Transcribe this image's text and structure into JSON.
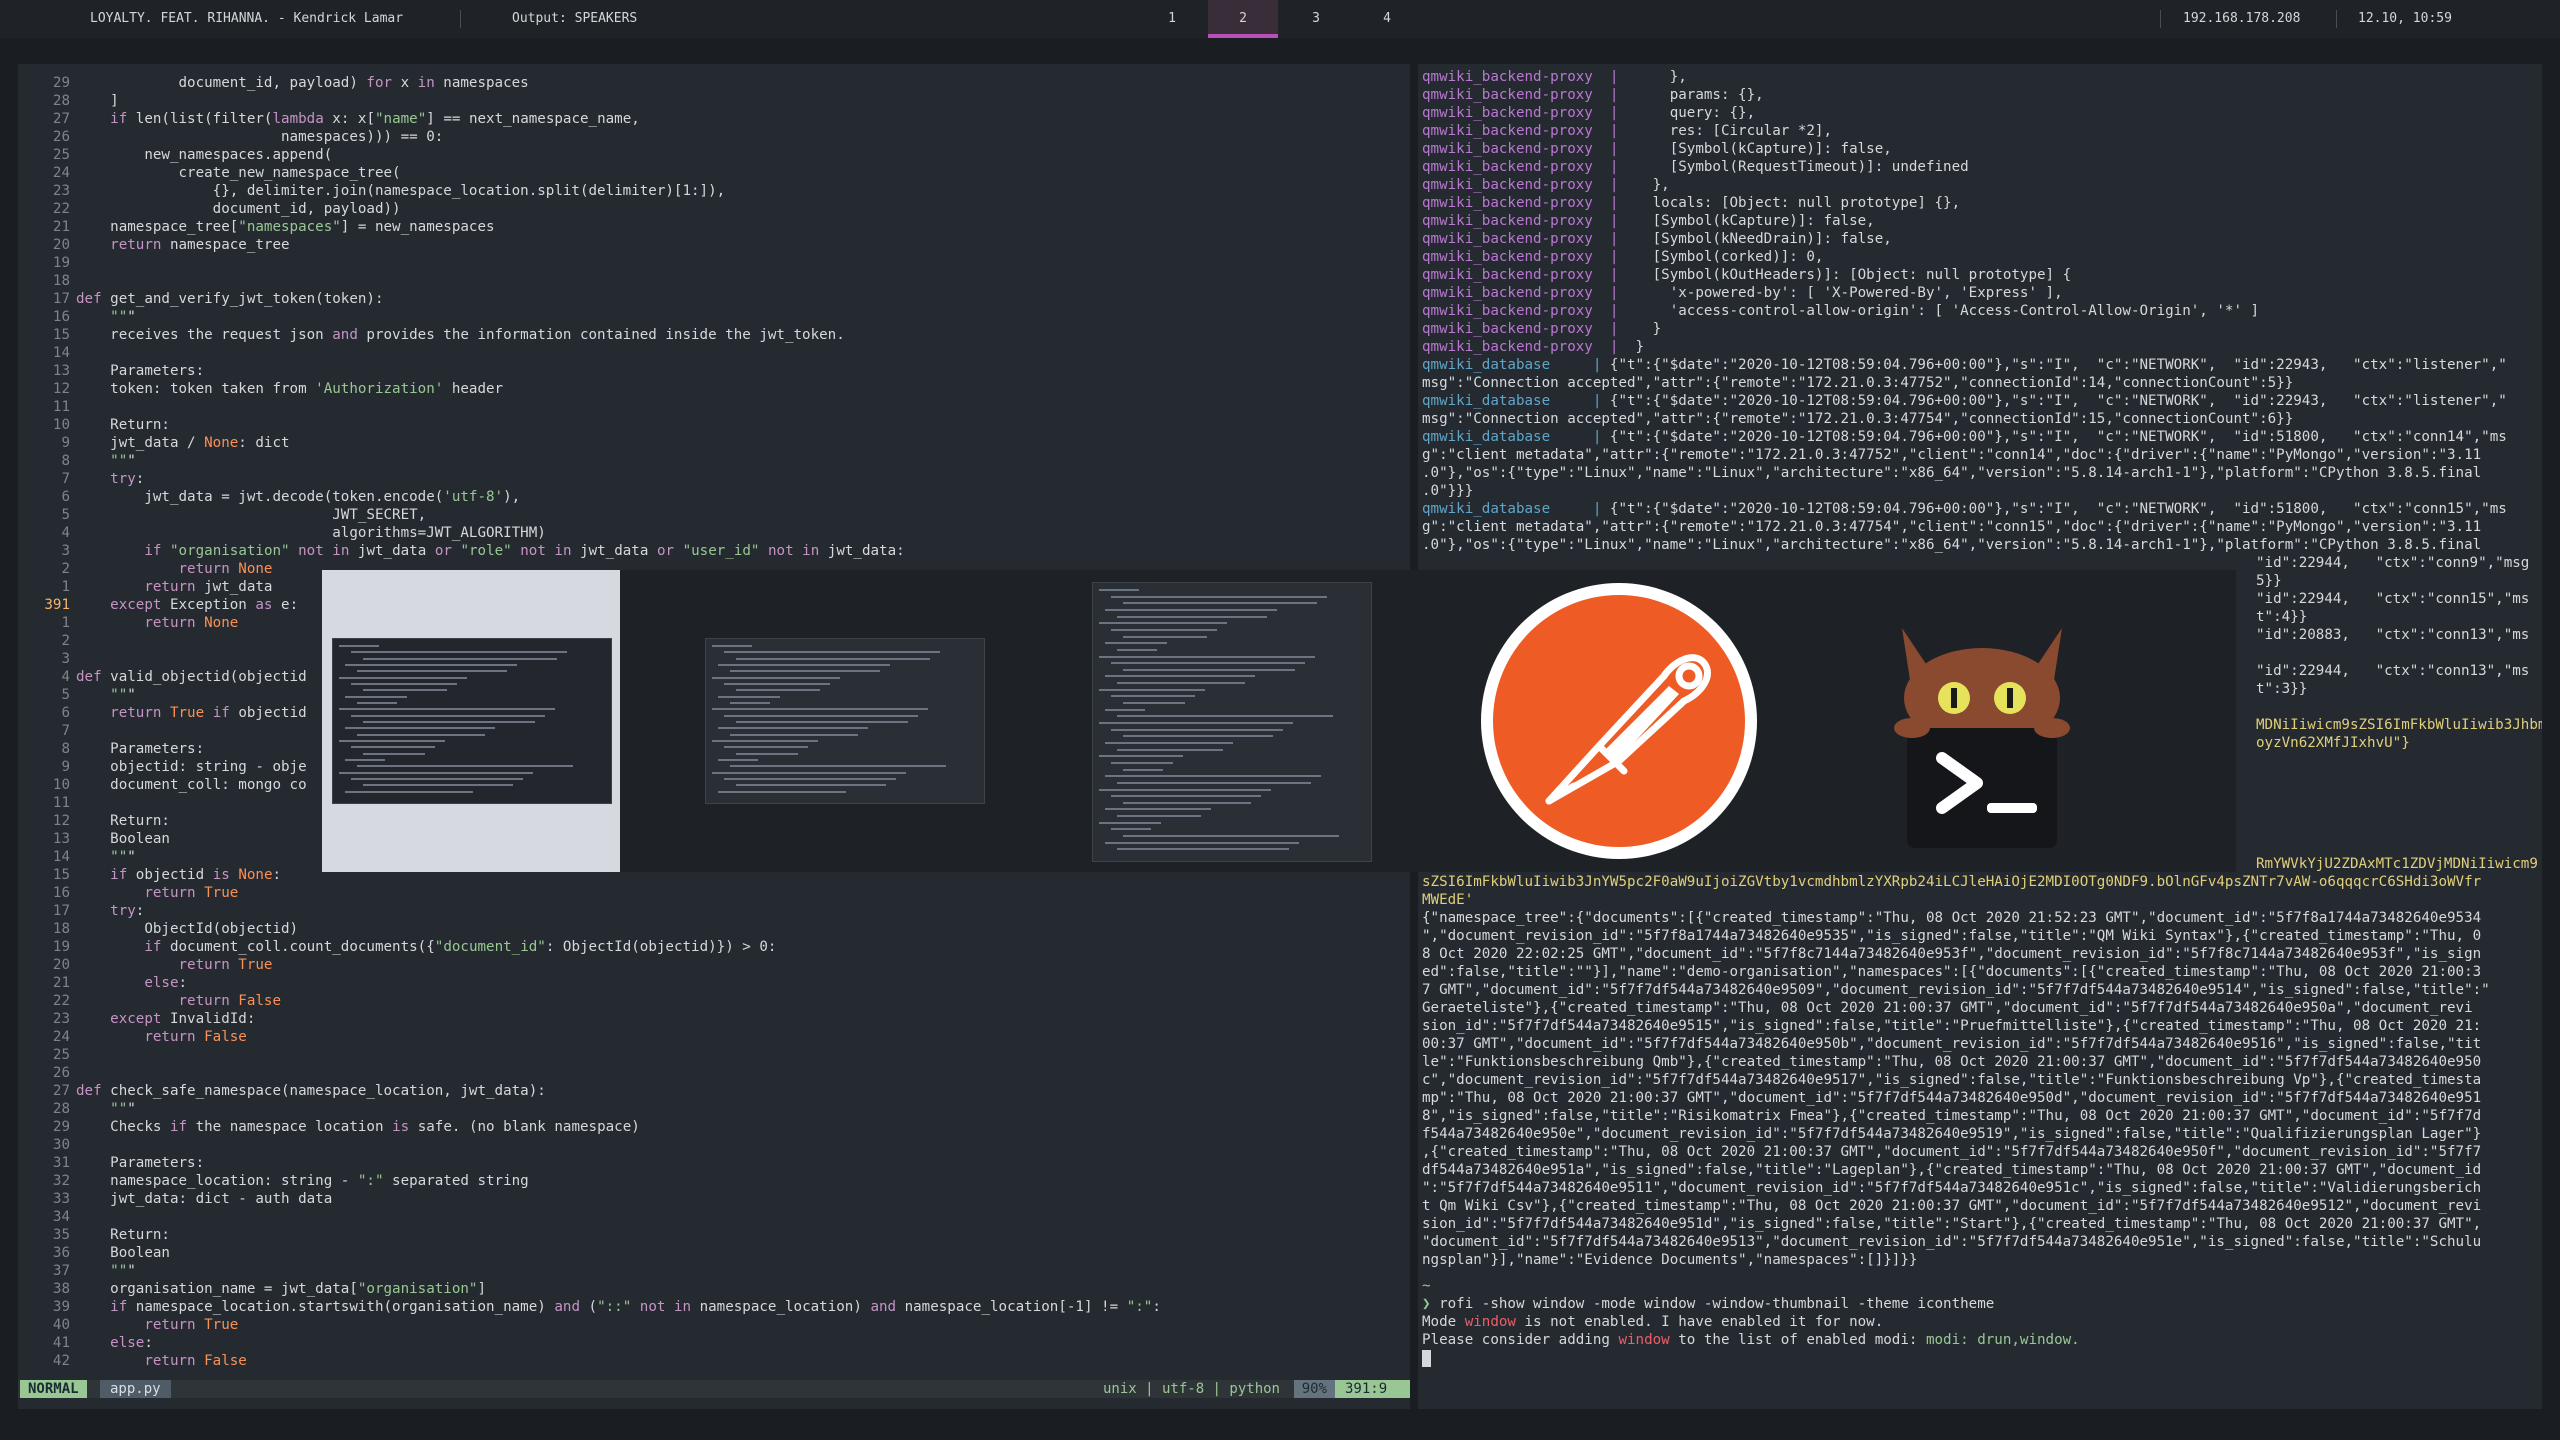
{
  "topbar": {
    "now_playing": "LOYALTY. FEAT. RIHANNA. - Kendrick Lamar",
    "audio_output": "Output: SPEAKERS",
    "workspaces": [
      "1",
      "2",
      "3",
      "4"
    ],
    "active_workspace": "2",
    "ip": "192.168.178.208",
    "datetime": "12.10, 10:59"
  },
  "editor": {
    "mode": "NORMAL",
    "filename": "app.py",
    "fileinfo": "unix | utf-8 | python",
    "percent": "90%",
    "position": "391:9",
    "lines": [
      {
        "n": "29",
        "t": "            document_id, payload) for x in namespaces"
      },
      {
        "n": "28",
        "t": "    ]"
      },
      {
        "n": "27",
        "t": "    if len(list(filter(lambda x: x[\"name\"] == next_namespace_name,"
      },
      {
        "n": "26",
        "t": "                        namespaces))) == 0:"
      },
      {
        "n": "25",
        "t": "        new_namespaces.append("
      },
      {
        "n": "24",
        "t": "            create_new_namespace_tree("
      },
      {
        "n": "23",
        "t": "                {}, delimiter.join(namespace_location.split(delimiter)[1:]),"
      },
      {
        "n": "22",
        "t": "                document_id, payload))"
      },
      {
        "n": "21",
        "t": "    namespace_tree[\"namespaces\"] = new_namespaces"
      },
      {
        "n": "20",
        "t": "    return namespace_tree"
      },
      {
        "n": "19",
        "t": ""
      },
      {
        "n": "18",
        "t": ""
      },
      {
        "n": "17",
        "t": "def get_and_verify_jwt_token(token):"
      },
      {
        "n": "16",
        "t": "    \"\"\""
      },
      {
        "n": "15",
        "t": "    receives the request json and provides the information contained inside the jwt_token."
      },
      {
        "n": "14",
        "t": ""
      },
      {
        "n": "13",
        "t": "    Parameters:"
      },
      {
        "n": "12",
        "t": "    token: token taken from 'Authorization' header"
      },
      {
        "n": "11",
        "t": ""
      },
      {
        "n": "10",
        "t": "    Return:"
      },
      {
        "n": "9",
        "t": "    jwt_data / None: dict"
      },
      {
        "n": "8",
        "t": "    \"\"\""
      },
      {
        "n": "7",
        "t": "    try:"
      },
      {
        "n": "6",
        "t": "        jwt_data = jwt.decode(token.encode('utf-8'),"
      },
      {
        "n": "5",
        "t": "                              JWT_SECRET,"
      },
      {
        "n": "4",
        "t": "                              algorithms=JWT_ALGORITHM)"
      },
      {
        "n": "3",
        "t": "        if \"organisation\" not in jwt_data or \"role\" not in jwt_data or \"user_id\" not in jwt_data:"
      },
      {
        "n": "2",
        "t": "            return None"
      },
      {
        "n": "1",
        "t": "        return jwt_data"
      },
      {
        "n": "391",
        "t": "    except Exception as e:"
      },
      {
        "n": "1",
        "t": "        return None"
      },
      {
        "n": "2",
        "t": ""
      },
      {
        "n": "3",
        "t": ""
      },
      {
        "n": "4",
        "t": "def valid_objectid(objectid"
      },
      {
        "n": "5",
        "t": "    \"\"\""
      },
      {
        "n": "6",
        "t": "    return True if objectid"
      },
      {
        "n": "7",
        "t": ""
      },
      {
        "n": "8",
        "t": "    Parameters:"
      },
      {
        "n": "9",
        "t": "    objectid: string - obje"
      },
      {
        "n": "10",
        "t": "    document_coll: mongo co"
      },
      {
        "n": "11",
        "t": ""
      },
      {
        "n": "12",
        "t": "    Return:"
      },
      {
        "n": "13",
        "t": "    Boolean"
      },
      {
        "n": "14",
        "t": "    \"\"\""
      },
      {
        "n": "15",
        "t": "    if objectid is None:"
      },
      {
        "n": "16",
        "t": "        return True"
      },
      {
        "n": "17",
        "t": "    try:"
      },
      {
        "n": "18",
        "t": "        ObjectId(objectid)"
      },
      {
        "n": "19",
        "t": "        if document_coll.count_documents({\"document_id\": ObjectId(objectid)}) > 0:"
      },
      {
        "n": "20",
        "t": "            return True"
      },
      {
        "n": "21",
        "t": "        else:"
      },
      {
        "n": "22",
        "t": "            return False"
      },
      {
        "n": "23",
        "t": "    except InvalidId:"
      },
      {
        "n": "24",
        "t": "        return False"
      },
      {
        "n": "25",
        "t": ""
      },
      {
        "n": "26",
        "t": ""
      },
      {
        "n": "27",
        "t": "def check_safe_namespace(namespace_location, jwt_data):"
      },
      {
        "n": "28",
        "t": "    \"\"\""
      },
      {
        "n": "29",
        "t": "    Checks if the namespace location is safe. (no blank namespace)"
      },
      {
        "n": "30",
        "t": ""
      },
      {
        "n": "31",
        "t": "    Parameters:"
      },
      {
        "n": "32",
        "t": "    namespace_location: string - \":\" separated string"
      },
      {
        "n": "33",
        "t": "    jwt_data: dict - auth data"
      },
      {
        "n": "34",
        "t": ""
      },
      {
        "n": "35",
        "t": "    Return:"
      },
      {
        "n": "36",
        "t": "    Boolean"
      },
      {
        "n": "37",
        "t": "    \"\"\""
      },
      {
        "n": "38",
        "t": "    organisation_name = jwt_data[\"organisation\"]"
      },
      {
        "n": "39",
        "t": "    if namespace_location.startswith(organisation_name) and (\"::\" not in namespace_location) and namespace_location[-1] != \":\":"
      },
      {
        "n": "40",
        "t": "        return True"
      },
      {
        "n": "41",
        "t": "    else:"
      },
      {
        "n": "42",
        "t": "        return False"
      }
    ]
  },
  "terminal": {
    "lines_top": [
      {
        "s": "qmwiki_backend-proxy  |",
        "t": "      },"
      },
      {
        "s": "qmwiki_backend-proxy  |",
        "t": "      params: {},"
      },
      {
        "s": "qmwiki_backend-proxy  |",
        "t": "      query: {},"
      },
      {
        "s": "qmwiki_backend-proxy  |",
        "t": "      res: [Circular *2],"
      },
      {
        "s": "qmwiki_backend-proxy  |",
        "t": "      [Symbol(kCapture)]: false,"
      },
      {
        "s": "qmwiki_backend-proxy  |",
        "t": "      [Symbol(RequestTimeout)]: undefined"
      },
      {
        "s": "qmwiki_backend-proxy  |",
        "t": "    },"
      },
      {
        "s": "qmwiki_backend-proxy  |",
        "t": "    locals: [Object: null prototype] {},"
      },
      {
        "s": "qmwiki_backend-proxy  |",
        "t": "    [Symbol(kCapture)]: false,"
      },
      {
        "s": "qmwiki_backend-proxy  |",
        "t": "    [Symbol(kNeedDrain)]: false,"
      },
      {
        "s": "qmwiki_backend-proxy  |",
        "t": "    [Symbol(corked)]: 0,"
      },
      {
        "s": "qmwiki_backend-proxy  |",
        "t": "    [Symbol(kOutHeaders)]: [Object: null prototype] {"
      },
      {
        "s": "qmwiki_backend-proxy  |",
        "t": "      'x-powered-by': [ 'X-Powered-By', 'Express' ],"
      },
      {
        "s": "qmwiki_backend-proxy  |",
        "t": "      'access-control-allow-origin': [ 'Access-Control-Allow-Origin', '*' ]"
      },
      {
        "s": "qmwiki_backend-proxy  |",
        "t": "    }"
      },
      {
        "s": "qmwiki_backend-proxy  |",
        "t": "  }"
      },
      {
        "s": "qmwiki_database     |",
        "t": " {\"t\":{\"$date\":\"2020-10-12T08:59:04.796+00:00\"},\"s\":\"I\",  \"c\":\"NETWORK\",  \"id\":22943,   \"ctx\":\"listener\",\""
      },
      {
        "s": "",
        "t": "msg\":\"Connection accepted\",\"attr\":{\"remote\":\"172.21.0.3:47752\",\"connectionId\":14,\"connectionCount\":5}}"
      },
      {
        "s": "qmwiki_database     |",
        "t": " {\"t\":{\"$date\":\"2020-10-12T08:59:04.796+00:00\"},\"s\":\"I\",  \"c\":\"NETWORK\",  \"id\":22943,   \"ctx\":\"listener\",\""
      },
      {
        "s": "",
        "t": "msg\":\"Connection accepted\",\"attr\":{\"remote\":\"172.21.0.3:47754\",\"connectionId\":15,\"connectionCount\":6}}"
      },
      {
        "s": "qmwiki_database     |",
        "t": " {\"t\":{\"$date\":\"2020-10-12T08:59:04.796+00:00\"},\"s\":\"I\",  \"c\":\"NETWORK\",  \"id\":51800,   \"ctx\":\"conn14\",\"ms"
      },
      {
        "s": "",
        "t": "g\":\"client metadata\",\"attr\":{\"remote\":\"172.21.0.3:47752\",\"client\":\"conn14\",\"doc\":{\"driver\":{\"name\":\"PyMongo\",\"version\":\"3.11"
      },
      {
        "s": "",
        "t": ".0\"},\"os\":{\"type\":\"Linux\",\"name\":\"Linux\",\"architecture\":\"x86_64\",\"version\":\"5.8.14-arch1-1\"},\"platform\":\"CPython 3.8.5.final"
      },
      {
        "s": "",
        "t": ".0\"}}}"
      },
      {
        "s": "qmwiki_database     |",
        "t": " {\"t\":{\"$date\":\"2020-10-12T08:59:04.796+00:00\"},\"s\":\"I\",  \"c\":\"NETWORK\",  \"id\":51800,   \"ctx\":\"conn15\",\"ms"
      },
      {
        "s": "",
        "t": "g\":\"client metadata\",\"attr\":{\"remote\":\"172.21.0.3:47754\",\"client\":\"conn15\",\"doc\":{\"driver\":{\"name\":\"PyMongo\",\"version\":\"3.11"
      },
      {
        "s": "",
        "t": ".0\"},\"os\":{\"type\":\"Linux\",\"name\":\"Linux\",\"architecture\":\"x86_64\",\"version\":\"5.8.14-arch1-1\"},\"platform\":\"CPython 3.8.5.final"
      }
    ],
    "lines_peek": [
      {
        "t": "\"id\":22944,   \"ctx\":\"conn9\",\"msg"
      },
      {
        "t": "5}}"
      },
      {
        "t": "\"id\":22944,   \"ctx\":\"conn15\",\"ms"
      },
      {
        "t": "t\":4}}"
      },
      {
        "t": "\"id\":20883,   \"ctx\":\"conn13\",\"ms"
      },
      {
        "t": ""
      },
      {
        "t": "\"id\":22944,   \"ctx\":\"conn13\",\"ms"
      },
      {
        "t": "t\":3}}"
      }
    ],
    "token_peek": [
      "MDNiIiwicm9sZSI6ImFkbWluIiwib3JhbmlzYXRpb24iOiJ",
      "oyzVn62XMfJIxhvU\"}"
    ],
    "token_peek2": "RmYWVkYjU2ZDAxMTc1ZDVjMDNiIiwicm9",
    "token_lines": [
      "sZSI6ImFkbWluIiwib3JnYW5pc2F0aW9uIjoiZGVtby1vcmdhbmlzYXRpb24iLCJleHAiOjE2MDI0OTg0NDF9.bOlnGFv4psZNTr7vAW-o6qqqcrC6SHdi3oWVfr",
      "MWEdE'"
    ],
    "json_lines": [
      "{\"namespace_tree\":{\"documents\":[{\"created_timestamp\":\"Thu, 08 Oct 2020 21:52:23 GMT\",\"document_id\":\"5f7f8a1744a73482640e9534",
      "\",\"document_revision_id\":\"5f7f8a1744a73482640e9535\",\"is_signed\":false,\"title\":\"QM Wiki Syntax\"},{\"created_timestamp\":\"Thu, 0",
      "8 Oct 2020 22:02:25 GMT\",\"document_id\":\"5f7f8c7144a73482640e953f\",\"document_revision_id\":\"5f7f8c7144a73482640e953f\",\"is_sign",
      "ed\":false,\"title\":\"\"}],\"name\":\"demo-organisation\",\"namespaces\":[{\"documents\":[{\"created_timestamp\":\"Thu, 08 Oct 2020 21:00:3",
      "7 GMT\",\"document_id\":\"5f7f7df544a73482640e9509\",\"document_revision_id\":\"5f7f7df544a73482640e9514\",\"is_signed\":false,\"title\":\"",
      "Geraeteliste\"},{\"created_timestamp\":\"Thu, 08 Oct 2020 21:00:37 GMT\",\"document_id\":\"5f7f7df544a73482640e950a\",\"document_revi",
      "sion_id\":\"5f7f7df544a73482640e9515\",\"is_signed\":false,\"title\":\"Pruefmittelliste\"},{\"created_timestamp\":\"Thu, 08 Oct 2020 21:",
      "00:37 GMT\",\"document_id\":\"5f7f7df544a73482640e950b\",\"document_revision_id\":\"5f7f7df544a73482640e9516\",\"is_signed\":false,\"tit",
      "le\":\"Funktionsbeschreibung Qmb\"},{\"created_timestamp\":\"Thu, 08 Oct 2020 21:00:37 GMT\",\"document_id\":\"5f7f7df544a73482640e950",
      "c\",\"document_revision_id\":\"5f7f7df544a73482640e9517\",\"is_signed\":false,\"title\":\"Funktionsbeschreibung Vp\"},{\"created_timesta",
      "mp\":\"Thu, 08 Oct 2020 21:00:37 GMT\",\"document_id\":\"5f7f7df544a73482640e950d\",\"document_revision_id\":\"5f7f7df544a73482640e951",
      "8\",\"is_signed\":false,\"title\":\"Risikomatrix Fmea\"},{\"created_timestamp\":\"Thu, 08 Oct 2020 21:00:37 GMT\",\"document_id\":\"5f7f7d",
      "f544a73482640e950e\",\"document_revision_id\":\"5f7f7df544a73482640e9519\",\"is_signed\":false,\"title\":\"Qualifizierungsplan Lager\"}",
      ",{\"created_timestamp\":\"Thu, 08 Oct 2020 21:00:37 GMT\",\"document_id\":\"5f7f7df544a73482640e950f\",\"document_revision_id\":\"5f7f7",
      "df544a73482640e951a\",\"is_signed\":false,\"title\":\"Lageplan\"},{\"created_timestamp\":\"Thu, 08 Oct 2020 21:00:37 GMT\",\"document_id",
      "\":\"5f7f7df544a73482640e9511\",\"document_revision_id\":\"5f7f7df544a73482640e951c\",\"is_signed\":false,\"title\":\"Validierungsberich",
      "t Qm Wiki Csv\"},{\"created_timestamp\":\"Thu, 08 Oct 2020 21:00:37 GMT\",\"document_id\":\"5f7f7df544a73482640e9512\",\"document_revi",
      "sion_id\":\"5f7f7df544a73482640e951d\",\"is_signed\":false,\"title\":\"Start\"},{\"created_timestamp\":\"Thu, 08 Oct 2020 21:00:37 GMT\",",
      "\"document_id\":\"5f7f7df544a73482640e9513\",\"document_revision_id\":\"5f7f7df544a73482640e951e\",\"is_signed\":false,\"title\":\"Schulu",
      "ngsplan\"}],\"name\":\"Evidence Documents\",\"namespaces\":[]}]}}"
    ],
    "tilde": "~",
    "prompt_symbol": "❯",
    "command": "rofi -show window -mode window -window-thumbnail -theme icontheme",
    "msg1_a": "Mode ",
    "msg1_w": "window",
    "msg1_b": " is not enabled. I have enabled it for now.",
    "msg2_a": "Please consider adding ",
    "msg2_w": "window",
    "msg2_b": " to the list of enabled modi: ",
    "msg2_c": "modi: drun,window."
  },
  "rofi": {
    "items": [
      "window-thumbnail-1",
      "window-thumbnail-2",
      "window-thumbnail-3",
      "postman-icon",
      "terminal-cat-icon"
    ],
    "selected": 0
  },
  "colors": {
    "accent": "#b84fb8",
    "postman_orange": "#ef5b25",
    "status_green": "#99c794"
  }
}
